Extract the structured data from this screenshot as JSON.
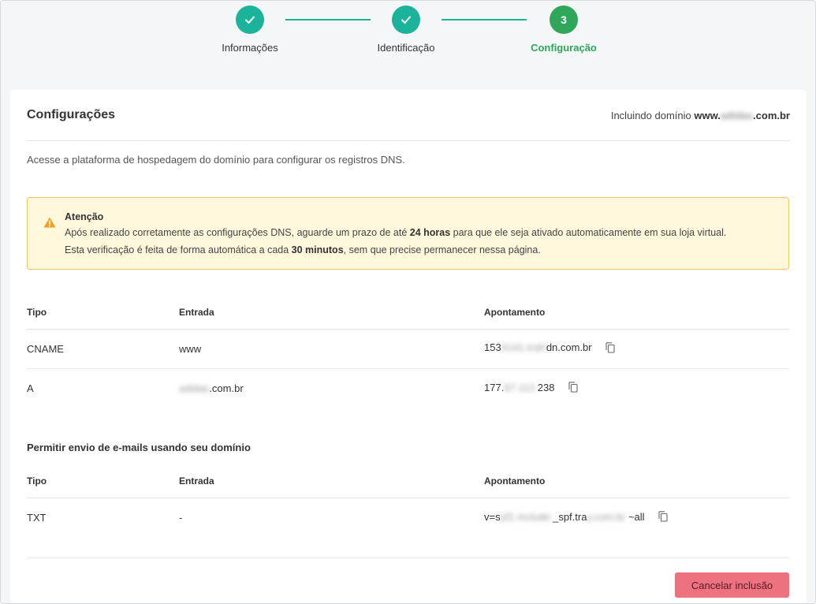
{
  "stepper": {
    "steps": [
      {
        "label": "Informações",
        "state": "done"
      },
      {
        "label": "Identificação",
        "state": "done"
      },
      {
        "label": "Configuração",
        "number": "3",
        "state": "current"
      }
    ],
    "colors": {
      "done": "#1bb39a",
      "current": "#2fa65a"
    }
  },
  "card": {
    "title": "Configurações",
    "including_prefix": "Incluindo domínio",
    "domain_prefix": "www.",
    "domain_hidden": "adidas",
    "domain_suffix": ".com.br",
    "intro": "Acesse a plataforma de hospedagem do domínio para configurar os registros DNS."
  },
  "alert": {
    "icon": "warning-icon",
    "title": "Atenção",
    "line1_a": "Após realizado corretamente as configurações DNS, aguarde um prazo de até ",
    "line1_b": "24 horas",
    "line1_c": " para que ele seja ativado automaticamente em sua loja virtual.",
    "line2_a": "Esta verificação é feita de forma automática a cada ",
    "line2_b": "30 minutos",
    "line2_c": ", sem que precise permanecer nessa página."
  },
  "dns_table": {
    "headers": [
      "Tipo",
      "Entrada",
      "Apontamento"
    ],
    "rows": [
      {
        "tipo": "CNAME",
        "entrada_hidden": "",
        "entrada": "www",
        "apont_a": "153",
        "apont_hidden": "4141.tcdn",
        "apont_b": "dn.com.br"
      },
      {
        "tipo": "A",
        "entrada_hidden": "adidas",
        "entrada": ".com.br",
        "apont_a": "177.",
        "apont_hidden": "67.112.",
        "apont_b": "238"
      }
    ]
  },
  "email_section": {
    "title": "Permitir envio de e-mails usando seu domínio",
    "headers": [
      "Tipo",
      "Entrada",
      "Apontamento"
    ],
    "rows": [
      {
        "tipo": "TXT",
        "entrada": "-",
        "apont_a": "v=s",
        "apont_hidden": "pf1 include:",
        "apont_b": "_spf.tra",
        "apont_hidden2": "y.com.br",
        "apont_c": " ~all"
      }
    ]
  },
  "footer": {
    "cancel_label": "Cancelar inclusão",
    "cancel_color": "#ec7280"
  }
}
